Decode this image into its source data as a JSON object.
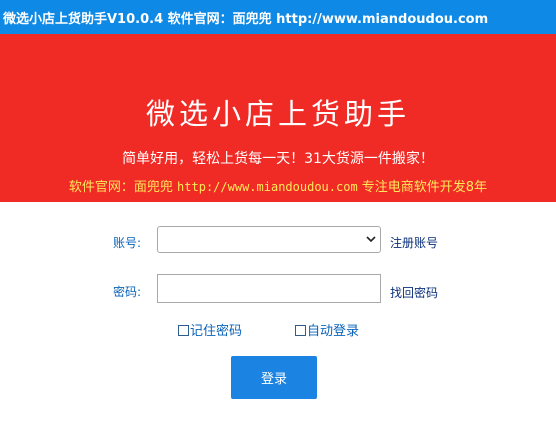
{
  "window": {
    "title": "微选小店上货助手V10.0.4  软件官网：面兜兜 http://www.miandoudou.com"
  },
  "banner": {
    "title": "微选小店上货助手",
    "slogan": "简单好用，轻松上货每一天！31大货源一件搬家！",
    "site_prefix": "软件官网：面兜兜 ",
    "site_url": "http://www.miandoudou.com",
    "site_suffix": " 专注电商软件开发8年"
  },
  "form": {
    "account_label": "账号:",
    "account_value": "",
    "register_link": "注册账号",
    "password_label": "密码:",
    "password_value": "",
    "forgot_link": "找回密码",
    "remember_label": "记住密码",
    "remember_checked": false,
    "autologin_label": "自动登录",
    "autologin_checked": false,
    "login_button": "登录"
  },
  "colors": {
    "titlebar": "#0e8ae6",
    "banner": "#f02a25",
    "banner_site_text": "#ffe85a",
    "label_text": "#0a63b8",
    "link_text": "#0a2f7a",
    "login_button": "#1b83e2"
  },
  "icons": {
    "dropdown": "chevron-down-icon"
  }
}
